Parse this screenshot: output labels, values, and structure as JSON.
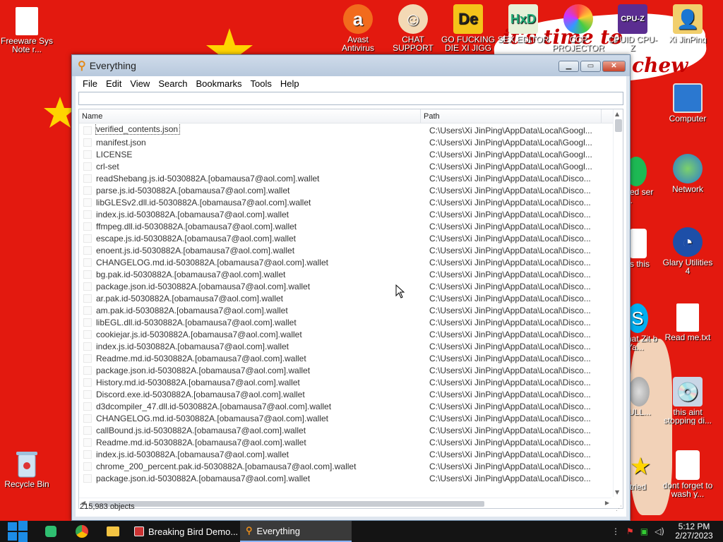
{
  "desktop": {
    "wallpaper_text_1": "it's time to",
    "wallpaper_text_2": "chew",
    "icons_left": [
      {
        "label": "Freeware Sys Note r...",
        "icon": "text-file-icon"
      },
      {
        "label": "Recycle Bin",
        "icon": "recycle-bin-icon"
      }
    ],
    "icons_top": [
      {
        "label": "Avast Antivirus",
        "icon": "avast-icon"
      },
      {
        "label": "CHAT SUPPORT",
        "icon": "support-person-icon"
      },
      {
        "label": "GO FUCKING DIE XI JIGG",
        "icon": "de-app-icon"
      },
      {
        "label": "SEX EDITOR",
        "icon": "hxd-icon"
      },
      {
        "label": "CCP PROJECTOR",
        "icon": "color-wheel-icon"
      },
      {
        "label": "CPUID CPU-Z",
        "icon": "cpuz-icon"
      },
      {
        "label": "Xi JinPing",
        "icon": "user-folder-icon"
      }
    ],
    "icons_right": [
      {
        "label": "Computer",
        "icon": "computer-icon"
      },
      {
        "label": "Network",
        "icon": "network-icon"
      },
      {
        "label": "Glary Utilities 4",
        "icon": "glary-icon"
      },
      {
        "label": "Read me.txt",
        "icon": "text-file-icon"
      },
      {
        "label": "this aint stopping di...",
        "icon": "installer-icon"
      },
      {
        "label": "dont forget to wash y...",
        "icon": "document-icon"
      }
    ],
    "icons_partial": [
      {
        "label": "sed ser ...",
        "icon": "spotify-icon"
      },
      {
        "label": "s this",
        "icon": "document-icon"
      },
      {
        "label": "hat Zit b Ya...",
        "icon": "skype-icon"
      },
      {
        "label": "ULL...",
        "icon": "disc-icon"
      },
      {
        "label": "tried",
        "icon": "star-icon"
      }
    ]
  },
  "window": {
    "title": "Everything",
    "menu": [
      "File",
      "Edit",
      "View",
      "Search",
      "Bookmarks",
      "Tools",
      "Help"
    ],
    "search_value": "",
    "columns": {
      "name": "Name",
      "path": "Path"
    },
    "rows": [
      {
        "name": "verified_contents.json",
        "path": "C:\\Users\\Xi JinPing\\AppData\\Local\\Googl..."
      },
      {
        "name": "manifest.json",
        "path": "C:\\Users\\Xi JinPing\\AppData\\Local\\Googl..."
      },
      {
        "name": "LICENSE",
        "path": "C:\\Users\\Xi JinPing\\AppData\\Local\\Googl..."
      },
      {
        "name": "crl-set",
        "path": "C:\\Users\\Xi JinPing\\AppData\\Local\\Googl..."
      },
      {
        "name": "readShebang.js.id-5030882A.[obamausa7@aol.com].wallet",
        "path": "C:\\Users\\Xi JinPing\\AppData\\Local\\Disco..."
      },
      {
        "name": "parse.js.id-5030882A.[obamausa7@aol.com].wallet",
        "path": "C:\\Users\\Xi JinPing\\AppData\\Local\\Disco..."
      },
      {
        "name": "libGLESv2.dll.id-5030882A.[obamausa7@aol.com].wallet",
        "path": "C:\\Users\\Xi JinPing\\AppData\\Local\\Disco..."
      },
      {
        "name": "index.js.id-5030882A.[obamausa7@aol.com].wallet",
        "path": "C:\\Users\\Xi JinPing\\AppData\\Local\\Disco..."
      },
      {
        "name": "ffmpeg.dll.id-5030882A.[obamausa7@aol.com].wallet",
        "path": "C:\\Users\\Xi JinPing\\AppData\\Local\\Disco..."
      },
      {
        "name": "escape.js.id-5030882A.[obamausa7@aol.com].wallet",
        "path": "C:\\Users\\Xi JinPing\\AppData\\Local\\Disco..."
      },
      {
        "name": "enoent.js.id-5030882A.[obamausa7@aol.com].wallet",
        "path": "C:\\Users\\Xi JinPing\\AppData\\Local\\Disco..."
      },
      {
        "name": "CHANGELOG.md.id-5030882A.[obamausa7@aol.com].wallet",
        "path": "C:\\Users\\Xi JinPing\\AppData\\Local\\Disco..."
      },
      {
        "name": "bg.pak.id-5030882A.[obamausa7@aol.com].wallet",
        "path": "C:\\Users\\Xi JinPing\\AppData\\Local\\Disco..."
      },
      {
        "name": "package.json.id-5030882A.[obamausa7@aol.com].wallet",
        "path": "C:\\Users\\Xi JinPing\\AppData\\Local\\Disco..."
      },
      {
        "name": "ar.pak.id-5030882A.[obamausa7@aol.com].wallet",
        "path": "C:\\Users\\Xi JinPing\\AppData\\Local\\Disco..."
      },
      {
        "name": "am.pak.id-5030882A.[obamausa7@aol.com].wallet",
        "path": "C:\\Users\\Xi JinPing\\AppData\\Local\\Disco..."
      },
      {
        "name": "libEGL.dll.id-5030882A.[obamausa7@aol.com].wallet",
        "path": "C:\\Users\\Xi JinPing\\AppData\\Local\\Disco..."
      },
      {
        "name": "cookiejar.js.id-5030882A.[obamausa7@aol.com].wallet",
        "path": "C:\\Users\\Xi JinPing\\AppData\\Local\\Disco..."
      },
      {
        "name": "index.js.id-5030882A.[obamausa7@aol.com].wallet",
        "path": "C:\\Users\\Xi JinPing\\AppData\\Local\\Disco..."
      },
      {
        "name": "Readme.md.id-5030882A.[obamausa7@aol.com].wallet",
        "path": "C:\\Users\\Xi JinPing\\AppData\\Local\\Disco..."
      },
      {
        "name": "package.json.id-5030882A.[obamausa7@aol.com].wallet",
        "path": "C:\\Users\\Xi JinPing\\AppData\\Local\\Disco..."
      },
      {
        "name": "History.md.id-5030882A.[obamausa7@aol.com].wallet",
        "path": "C:\\Users\\Xi JinPing\\AppData\\Local\\Disco..."
      },
      {
        "name": "Discord.exe.id-5030882A.[obamausa7@aol.com].wallet",
        "path": "C:\\Users\\Xi JinPing\\AppData\\Local\\Disco..."
      },
      {
        "name": "d3dcompiler_47.dll.id-5030882A.[obamausa7@aol.com].wallet",
        "path": "C:\\Users\\Xi JinPing\\AppData\\Local\\Disco..."
      },
      {
        "name": "CHANGELOG.md.id-5030882A.[obamausa7@aol.com].wallet",
        "path": "C:\\Users\\Xi JinPing\\AppData\\Local\\Disco..."
      },
      {
        "name": "callBound.js.id-5030882A.[obamausa7@aol.com].wallet",
        "path": "C:\\Users\\Xi JinPing\\AppData\\Local\\Disco..."
      },
      {
        "name": "Readme.md.id-5030882A.[obamausa7@aol.com].wallet",
        "path": "C:\\Users\\Xi JinPing\\AppData\\Local\\Disco..."
      },
      {
        "name": "index.js.id-5030882A.[obamausa7@aol.com].wallet",
        "path": "C:\\Users\\Xi JinPing\\AppData\\Local\\Disco..."
      },
      {
        "name": "chrome_200_percent.pak.id-5030882A.[obamausa7@aol.com].wallet",
        "path": "C:\\Users\\Xi JinPing\\AppData\\Local\\Disco..."
      },
      {
        "name": "package.json.id-5030882A.[obamausa7@aol.com].wallet",
        "path": "C:\\Users\\Xi JinPing\\AppData\\Local\\Disco..."
      }
    ],
    "status": "215,983 objects"
  },
  "taskbar": {
    "tasks": [
      {
        "label": "Breaking Bird Demo...",
        "icon": "bird-game-icon",
        "active": false
      },
      {
        "label": "Everything",
        "icon": "everything-search-icon",
        "active": true
      }
    ],
    "time": "5:12 PM",
    "date": "2/27/2023"
  },
  "colors": {
    "wallpaper": "#e3190f",
    "accent_title": "#b8c9dd",
    "taskbar": "#141414"
  }
}
